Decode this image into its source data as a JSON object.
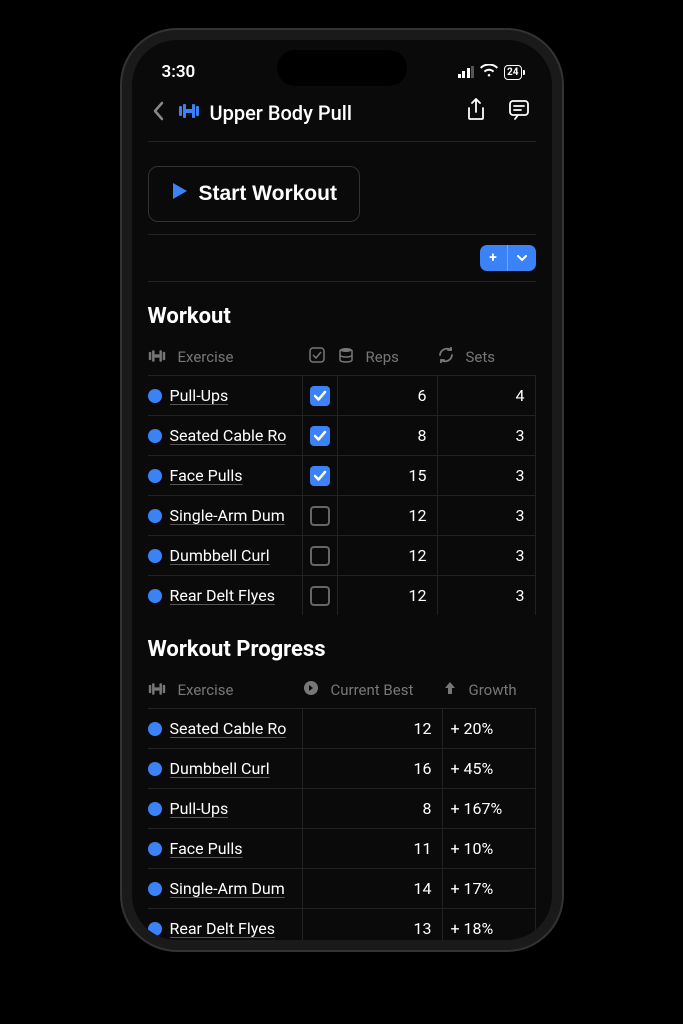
{
  "status": {
    "time": "3:30",
    "battery": "24"
  },
  "header": {
    "title": "Upper Body Pull"
  },
  "start_button": "Start Workout",
  "workout": {
    "title": "Workout",
    "cols": {
      "exercise": "Exercise",
      "reps": "Reps",
      "sets": "Sets"
    },
    "rows": [
      {
        "name": "Pull-Ups",
        "checked": true,
        "reps": "6",
        "sets": "4"
      },
      {
        "name": "Seated Cable Ro",
        "checked": true,
        "reps": "8",
        "sets": "3"
      },
      {
        "name": "Face Pulls",
        "checked": true,
        "reps": "15",
        "sets": "3"
      },
      {
        "name": "Single-Arm Dum",
        "checked": false,
        "reps": "12",
        "sets": "3"
      },
      {
        "name": "Dumbbell Curl",
        "checked": false,
        "reps": "12",
        "sets": "3"
      },
      {
        "name": "Rear Delt Flyes",
        "checked": false,
        "reps": "12",
        "sets": "3"
      }
    ]
  },
  "progress": {
    "title": "Workout Progress",
    "cols": {
      "exercise": "Exercise",
      "current_best": "Current Best",
      "growth": "Growth"
    },
    "rows": [
      {
        "name": "Seated Cable Ro",
        "best": "12",
        "growth": "+ 20%"
      },
      {
        "name": "Dumbbell Curl",
        "best": "16",
        "growth": "+ 45%"
      },
      {
        "name": "Pull-Ups",
        "best": "8",
        "growth": "+ 167%"
      },
      {
        "name": "Face Pulls",
        "best": "11",
        "growth": "+ 10%"
      },
      {
        "name": "Single-Arm Dum",
        "best": "14",
        "growth": "+ 17%"
      },
      {
        "name": "Rear Delt Flyes",
        "best": "13",
        "growth": "+ 18%"
      }
    ]
  }
}
